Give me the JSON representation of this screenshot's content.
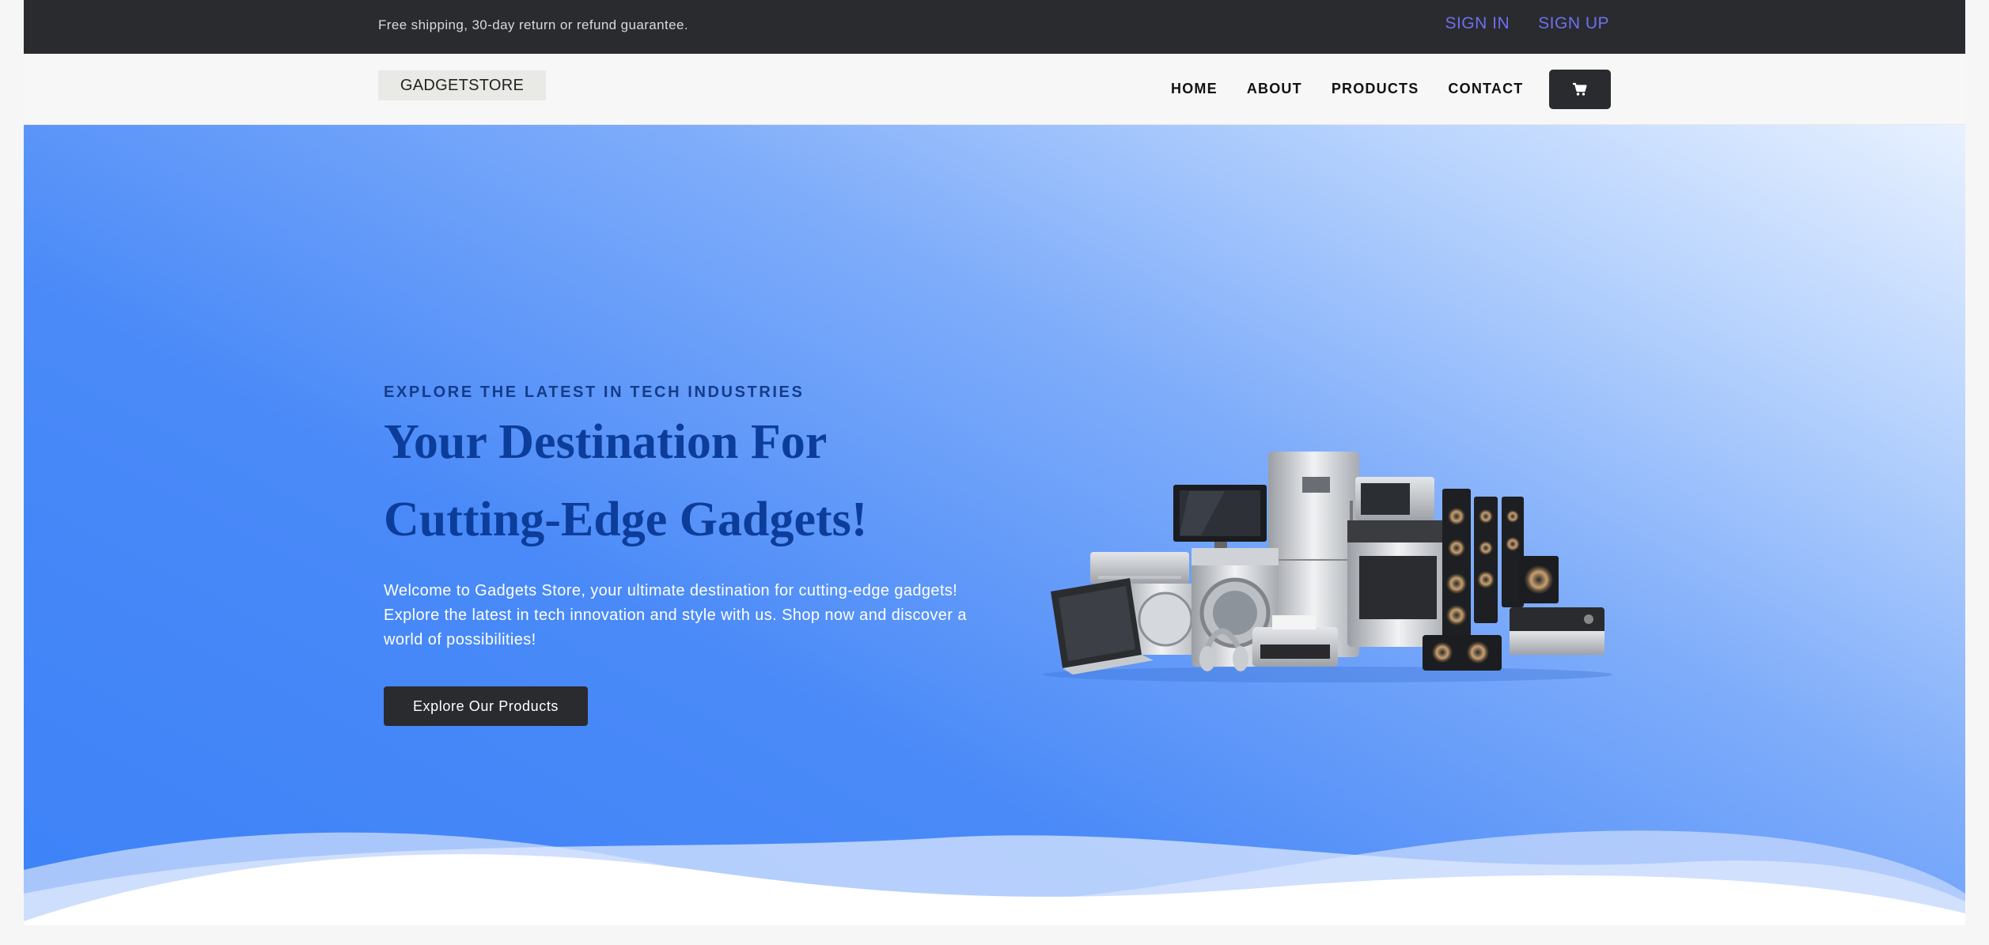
{
  "topbar": {
    "message": "Free shipping, 30-day return or refund guarantee.",
    "sign_in": "SIGN IN",
    "sign_up": "SIGN UP"
  },
  "nav": {
    "logo_text": "GADGETSTORE",
    "items": [
      "HOME",
      "ABOUT",
      "PRODUCTS",
      "CONTACT"
    ],
    "cart_icon": "cart-icon"
  },
  "hero": {
    "eyebrow": "EXPLORE THE LATEST IN TECH INDUSTRIES",
    "headline_line1": "Your Destination For",
    "headline_line2": "Cutting-Edge Gadgets!",
    "description": "Welcome to Gadgets Store, your ultimate destination for cutting-edge gadgets! Explore the latest in tech innovation and style with us. Shop now and discover a world of possibilities!",
    "cta_label": "Explore Our Products",
    "image_icon": "appliances-illustration"
  },
  "colors": {
    "topbar_bg": "#2a2b2f",
    "auth_link": "#6f6ff0",
    "headline": "#0c3d9a",
    "hero_blue": "#3d82f8"
  }
}
